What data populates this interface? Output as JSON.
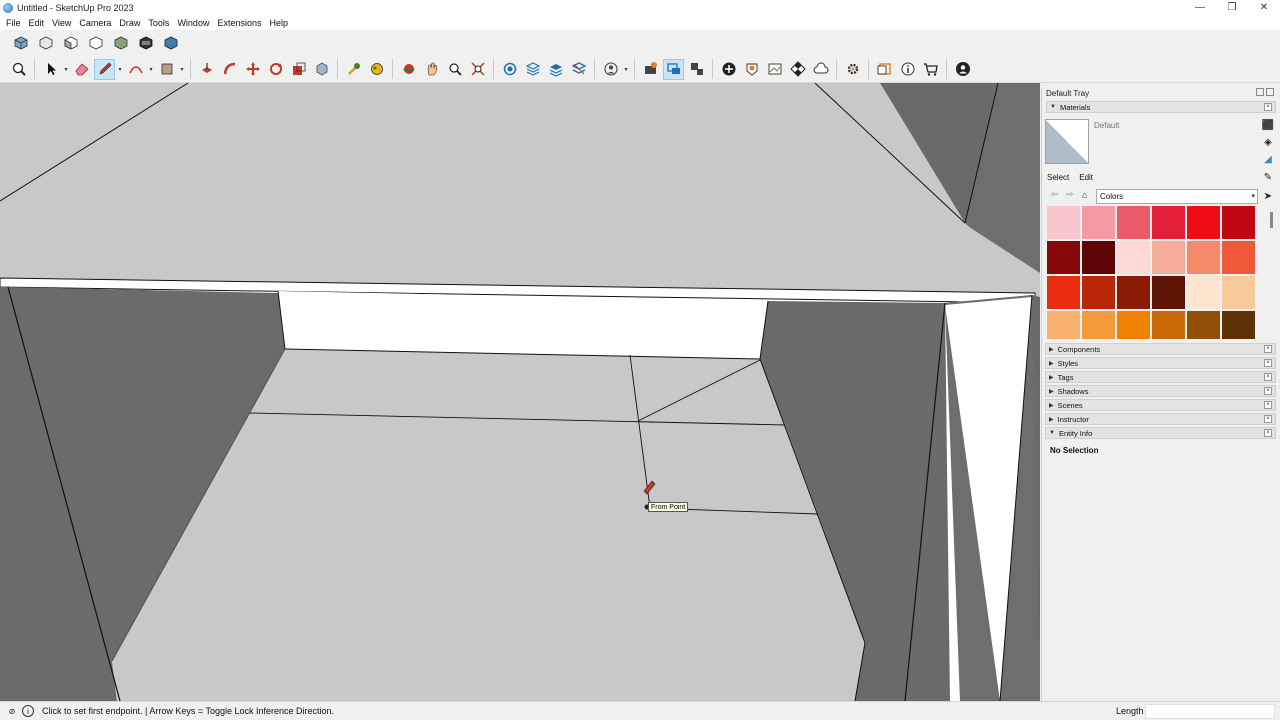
{
  "window": {
    "title": "Untitled - SketchUp Pro 2023",
    "minimize": "—",
    "maximize": "❐",
    "close": "✕"
  },
  "menu": [
    "File",
    "Edit",
    "View",
    "Camera",
    "Draw",
    "Tools",
    "Window",
    "Extensions",
    "Help"
  ],
  "toolbar1": [
    "iso-view-icon",
    "top-view-icon",
    "front-view-icon",
    "right-view-icon",
    "back-view-icon",
    "left-view-icon",
    "bottom-view-icon"
  ],
  "toolbar2": [
    "zoom-icon",
    "select-icon",
    "eraser-icon",
    "pencil-icon",
    "arc-icon",
    "rectangle-icon",
    "push-pull-icon",
    "follow-me-icon",
    "move-icon",
    "rotate-icon",
    "scale-icon",
    "offset-icon",
    "tape-measure-icon",
    "paint-bucket-icon",
    "orbit-icon",
    "pan-icon",
    "zoom-window-icon",
    "zoom-extents-icon"
  ],
  "viewport": {
    "tooltip": "From Point"
  },
  "tray": {
    "title": "Default Tray",
    "materials": {
      "header": "Materials",
      "current_name": "Default",
      "tab_select": "Select",
      "tab_edit": "Edit",
      "library": "Colors",
      "swatches": [
        "#f8c6cc",
        "#f39aa2",
        "#ec5b6a",
        "#e41f3a",
        "#ee0d14",
        "#c00712",
        "#850708",
        "#5c0406",
        "#fcd9d2",
        "#f6ab9b",
        "#f58a6a",
        "#f0583a",
        "#eb2d0f",
        "#b82508",
        "#8a1c06",
        "#5e1505",
        "#fde6cf",
        "#f8c99b",
        "#f7b06d",
        "#f39a3a",
        "#ef8204",
        "#c86807",
        "#924d07",
        "#5e3204"
      ]
    },
    "panels": [
      "Components",
      "Styles",
      "Tags",
      "Shadows",
      "Scenes",
      "Instructor"
    ],
    "entity_info": {
      "header": "Entity Info",
      "body": "No Selection"
    }
  },
  "status": {
    "text": "Click to set first endpoint. | Arrow Keys = Toggle Lock Inference Direction.",
    "measure_label": "Length",
    "measure_value": ""
  }
}
